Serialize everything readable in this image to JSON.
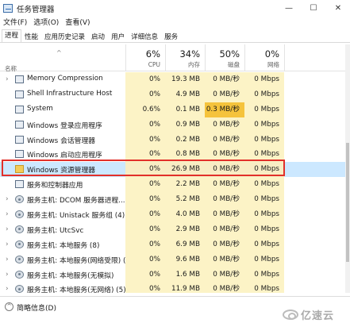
{
  "window": {
    "title": "任务管理器",
    "controls": {
      "minimize": "—",
      "maximize": "☐",
      "close": "✕"
    }
  },
  "menu": [
    "文件(F)",
    "选项(O)",
    "查看(V)"
  ],
  "tabs": [
    "进程",
    "性能",
    "应用历史记录",
    "启动",
    "用户",
    "详细信息",
    "服务"
  ],
  "active_tab": 0,
  "header": {
    "sort_indicator": "^",
    "name_label": "名称",
    "cpu": {
      "pct": "6%",
      "label": "CPU"
    },
    "memory": {
      "pct": "34%",
      "label": "内存"
    },
    "disk": {
      "pct": "50%",
      "label": "磁盘"
    },
    "network": {
      "pct": "0%",
      "label": "网络"
    }
  },
  "processes": [
    {
      "expand": "›",
      "icon": "app",
      "name": "Memory Compression",
      "cpu": "0%",
      "mem": "19.3 MB",
      "disk": "0 MB/秒",
      "net": "0 Mbps"
    },
    {
      "expand": "",
      "icon": "app",
      "name": "Shell Infrastructure Host",
      "cpu": "0%",
      "mem": "4.9 MB",
      "disk": "0 MB/秒",
      "net": "0 Mbps"
    },
    {
      "expand": "",
      "icon": "app",
      "name": "System",
      "cpu": "0.6%",
      "mem": "0.1 MB",
      "disk": "0.3 MB/秒",
      "net": "0 Mbps",
      "disk_hot": true
    },
    {
      "expand": "",
      "icon": "app",
      "name": "Windows 登录应用程序",
      "cpu": "0%",
      "mem": "0.9 MB",
      "disk": "0 MB/秒",
      "net": "0 Mbps"
    },
    {
      "expand": "",
      "icon": "app",
      "name": "Windows 会话管理器",
      "cpu": "0%",
      "mem": "0.2 MB",
      "disk": "0 MB/秒",
      "net": "0 Mbps"
    },
    {
      "expand": "",
      "icon": "app",
      "name": "Windows 启动应用程序",
      "cpu": "0%",
      "mem": "0.8 MB",
      "disk": "0 MB/秒",
      "net": "0 Mbps"
    },
    {
      "expand": "",
      "icon": "folder",
      "name": "Windows 资源管理器",
      "cpu": "0%",
      "mem": "26.9 MB",
      "disk": "0 MB/秒",
      "net": "0 Mbps",
      "selected": true
    },
    {
      "expand": "",
      "icon": "app",
      "name": "服务和控制器应用",
      "cpu": "0%",
      "mem": "2.2 MB",
      "disk": "0 MB/秒",
      "net": "0 Mbps"
    },
    {
      "expand": "›",
      "icon": "gear",
      "name": "服务主机: DCOM 服务器进程...",
      "cpu": "0%",
      "mem": "5.2 MB",
      "disk": "0 MB/秒",
      "net": "0 Mbps"
    },
    {
      "expand": "›",
      "icon": "gear",
      "name": "服务主机: Unistack 服务组 (4)",
      "cpu": "0%",
      "mem": "4.0 MB",
      "disk": "0 MB/秒",
      "net": "0 Mbps"
    },
    {
      "expand": "›",
      "icon": "gear",
      "name": "服务主机: UtcSvc",
      "cpu": "0%",
      "mem": "2.9 MB",
      "disk": "0 MB/秒",
      "net": "0 Mbps"
    },
    {
      "expand": "›",
      "icon": "gear",
      "name": "服务主机: 本地服务 (8)",
      "cpu": "0%",
      "mem": "6.9 MB",
      "disk": "0 MB/秒",
      "net": "0 Mbps"
    },
    {
      "expand": "›",
      "icon": "gear",
      "name": "服务主机: 本地服务(网络受限) (...",
      "cpu": "0%",
      "mem": "9.6 MB",
      "disk": "0 MB/秒",
      "net": "0 Mbps"
    },
    {
      "expand": "›",
      "icon": "gear",
      "name": "服务主机: 本地服务(无模拟)",
      "cpu": "0%",
      "mem": "1.6 MB",
      "disk": "0 MB/秒",
      "net": "0 Mbps"
    },
    {
      "expand": "›",
      "icon": "gear",
      "name": "服务主机: 本地服务(无网络) (5)",
      "cpu": "0%",
      "mem": "11.9 MB",
      "disk": "0 MB/秒",
      "net": "0 Mbps"
    }
  ],
  "footer": {
    "fewer_details": "简略信息(D)",
    "fewer_icon_glyph": "^"
  },
  "watermark": {
    "text": "亿速云"
  },
  "colors": {
    "heat_light": "#fcf3c6",
    "heat_hot": "#f5c33c",
    "selected": "#cce8ff",
    "annotation": "#e2302a"
  }
}
